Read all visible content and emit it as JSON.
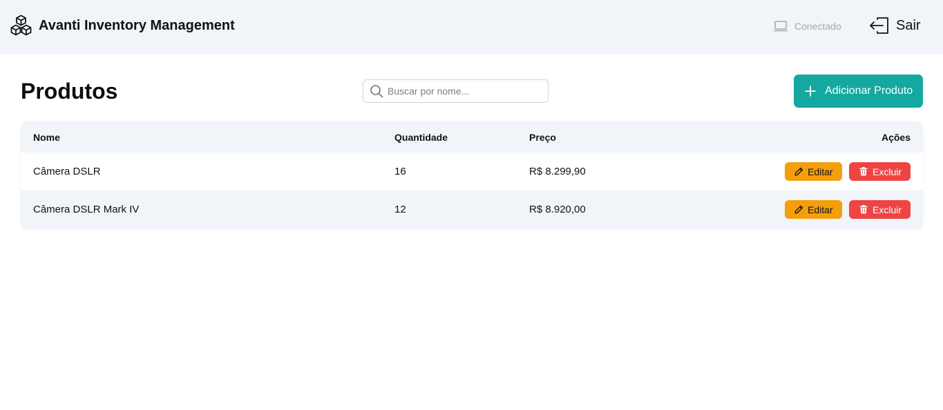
{
  "header": {
    "title": "Avanti Inventory Management",
    "status_label": "Conectado",
    "logout_label": "Sair"
  },
  "main": {
    "page_title": "Produtos",
    "search": {
      "placeholder": "Buscar por nome...",
      "value": ""
    },
    "add_button_label": "Adicionar Produto"
  },
  "table": {
    "columns": [
      "Nome",
      "Quantidade",
      "Preço",
      "Ações"
    ],
    "rows": [
      {
        "name": "Câmera DSLR",
        "quantity": "16",
        "price": "R$ 8.299,90",
        "edit_label": "Editar",
        "delete_label": "Excluir"
      },
      {
        "name": "Câmera DSLR Mark IV",
        "quantity": "12",
        "price": "R$ 8.920,00",
        "edit_label": "Editar",
        "delete_label": "Excluir"
      }
    ]
  },
  "icons": {
    "logo": "cubes-icon",
    "status": "laptop-icon",
    "logout": "logout-icon",
    "search": "search-icon",
    "add": "plus-icon",
    "edit": "pencil-icon",
    "delete": "trash-icon"
  },
  "colors": {
    "header_bg": "#f1f4f8",
    "accent": "#14a8a0",
    "edit": "#f59e0b",
    "delete": "#ef4444",
    "status_muted": "#a3a9b3"
  }
}
